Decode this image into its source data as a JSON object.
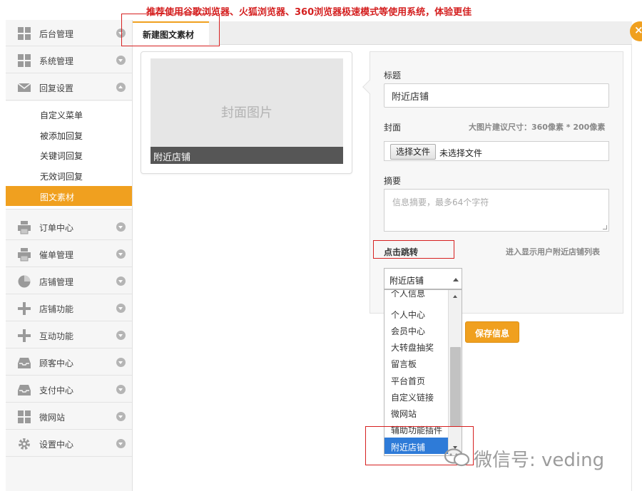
{
  "banner": {
    "text": "推荐使用谷歌浏览器、火狐浏览器、360浏览器极速模式等使用系统，体验更佳"
  },
  "sidebar": {
    "items": [
      {
        "label": "后台管理",
        "icon": "grid-icon"
      },
      {
        "label": "系统管理",
        "icon": "grid-icon"
      },
      {
        "label": "回复设置",
        "icon": "mail-icon"
      },
      {
        "label": "订单中心",
        "icon": "printer-icon"
      },
      {
        "label": "催单管理",
        "icon": "printer-icon"
      },
      {
        "label": "店铺管理",
        "icon": "pie-chart-icon"
      },
      {
        "label": "店铺功能",
        "icon": "plus-icon"
      },
      {
        "label": "互动功能",
        "icon": "plus-icon"
      },
      {
        "label": "顾客中心",
        "icon": "inbox-icon"
      },
      {
        "label": "支付中心",
        "icon": "inbox-icon"
      },
      {
        "label": "微网站",
        "icon": "grid-icon"
      },
      {
        "label": "设置中心",
        "icon": "gear-icon"
      }
    ],
    "sub_items": [
      {
        "label": "自定义菜单"
      },
      {
        "label": "被添加回复"
      },
      {
        "label": "关键词回复"
      },
      {
        "label": "无效词回复"
      },
      {
        "label": "图文素材",
        "active": true
      }
    ]
  },
  "tabs": {
    "active": "新建图文素材"
  },
  "preview": {
    "cover_placeholder": "封面图片",
    "title": "附近店铺"
  },
  "form": {
    "title_label": "标题",
    "title_value": "附近店铺",
    "cover_label": "封面",
    "cover_hint": "大图片建议尺寸：360像素 * 200像素",
    "file_button": "选择文件",
    "file_status": "未选择文件",
    "summary_label": "摘要",
    "summary_placeholder": "信息摘要，最多64个字符",
    "jump_label": "点击跳转",
    "jump_hint": "进入显示用户附近店铺列表",
    "select_value": "附近店铺",
    "options": [
      "个人信息",
      "个人中心",
      "会员中心",
      "大转盘抽奖",
      "留言板",
      "平台首页",
      "自定义链接",
      "微网站",
      "辅助功能插件",
      "附近店铺"
    ],
    "save_button": "保存信息"
  },
  "watermark": {
    "text": "微信号: veding"
  },
  "colors": {
    "accent": "#f0a01f",
    "highlight_border": "#d62020",
    "selected_option": "#2e7bd8"
  }
}
